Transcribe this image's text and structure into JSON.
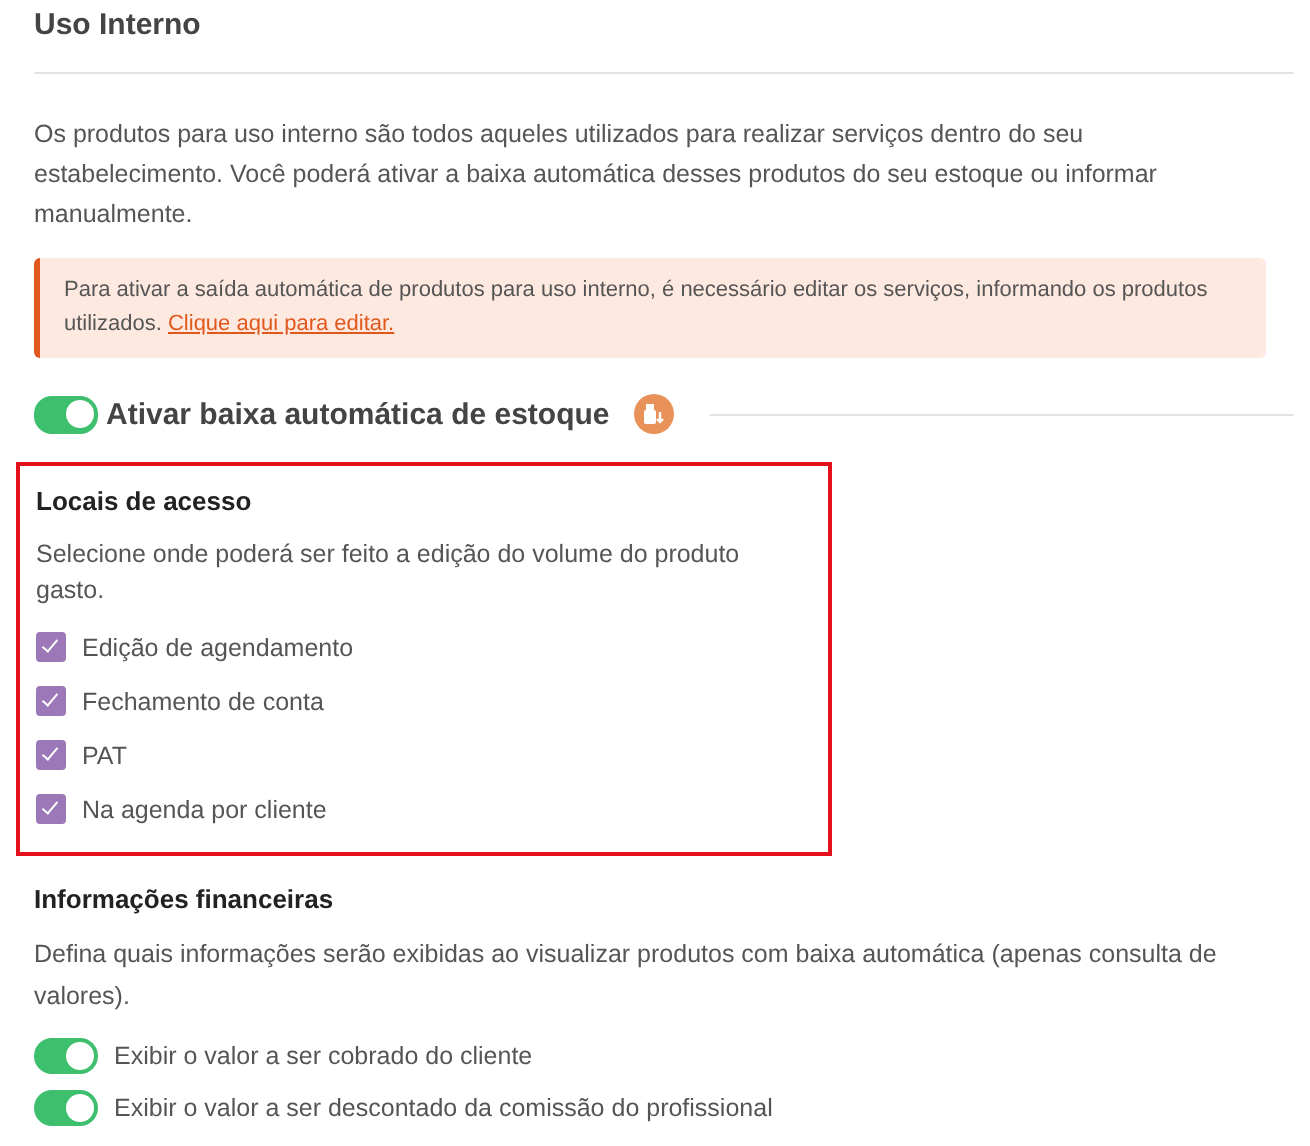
{
  "title": "Uso Interno",
  "intro": "Os produtos para uso interno são todos aqueles utilizados para realizar serviços dentro do seu estabelecimento. Você poderá ativar a baixa automática desses produtos do seu estoque ou informar manualmente.",
  "alert": {
    "text": "Para ativar a saída automática de produtos para uso interno, é necessário editar os serviços, informando os produtos utilizados.",
    "link": "Clique aqui para editar."
  },
  "auto_toggle": {
    "label": "Ativar baixa automática de estoque",
    "on": true
  },
  "access": {
    "heading": "Locais de acesso",
    "description": "Selecione onde poderá ser feito a edição do volume do produto gasto.",
    "highlighted": true,
    "options": [
      {
        "label": "Edição de agendamento",
        "checked": true
      },
      {
        "label": "Fechamento de conta",
        "checked": true
      },
      {
        "label": "PAT",
        "checked": true
      },
      {
        "label": "Na agenda por cliente",
        "checked": true
      }
    ]
  },
  "financial": {
    "heading": "Informações financeiras",
    "description": "Defina quais informações serão exibidas ao visualizar produtos com baixa automática (apenas consulta de valores).",
    "toggles": [
      {
        "label": "Exibir o valor a ser cobrado do cliente",
        "on": true
      },
      {
        "label": "Exibir o valor a ser descontado da comissão do profissional",
        "on": true
      }
    ]
  }
}
